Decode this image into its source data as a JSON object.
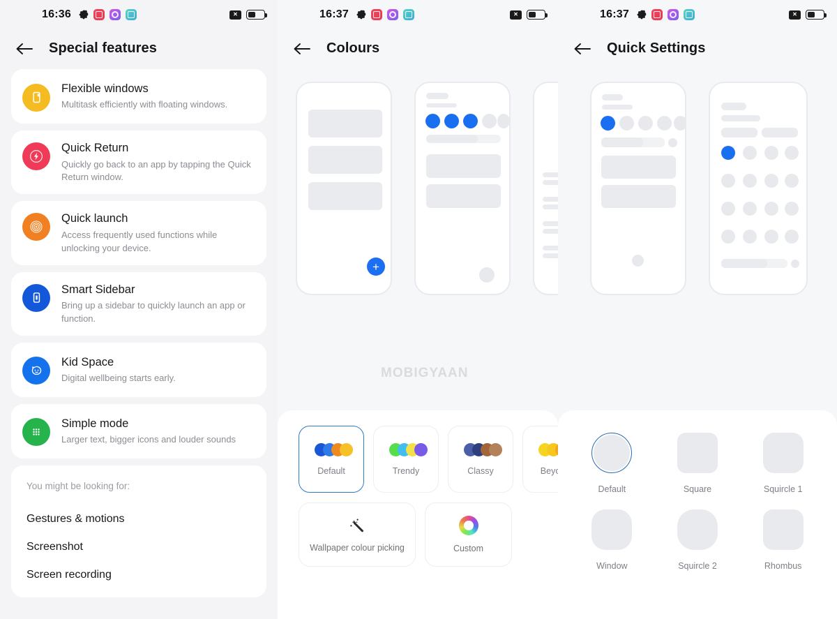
{
  "panels": [
    {
      "id": "special-features",
      "statusbar": {
        "time": "16:36",
        "icons": [
          "gear-icon",
          "app-red-icon",
          "app-purple-icon",
          "app-teal-icon"
        ],
        "right_icons": [
          "x-badge-icon",
          "battery-icon"
        ],
        "battery_level": "48%"
      },
      "appbar": {
        "back": "back-arrow",
        "title": "Special features"
      },
      "features": [
        {
          "title": "Flexible windows",
          "subtitle": "Multitask efficiently with floating windows.",
          "icon": "window-icon",
          "color": "#f5bc21"
        },
        {
          "title": "Quick Return",
          "subtitle": "Quickly go back to an app by tapping the Quick Return window.",
          "icon": "lightning-circle-icon",
          "color": "#ef3b57"
        },
        {
          "title": "Quick launch",
          "subtitle": "Access frequently used functions while unlocking your device.",
          "icon": "fingerprint-icon",
          "color": "#f08021"
        },
        {
          "title": "Smart Sidebar",
          "subtitle": "Bring up a sidebar to quickly launch an app or function.",
          "icon": "sidebar-icon",
          "color": "#1258d8"
        },
        {
          "title": "Kid Space",
          "subtitle": "Digital wellbeing starts early.",
          "icon": "kid-face-icon",
          "color": "#1472ec"
        },
        {
          "title": "Simple mode",
          "subtitle": "Larger text, bigger icons and louder sounds",
          "icon": "grid-dots-icon",
          "color": "#27b34c"
        }
      ],
      "looking_for": {
        "header": "You might be looking for:",
        "items": [
          "Gestures & motions",
          "Screenshot",
          "Screen recording"
        ]
      }
    },
    {
      "id": "colours",
      "statusbar": {
        "time": "16:37",
        "icons": [
          "gear-icon",
          "app-red-icon",
          "app-purple-icon",
          "app-teal-icon"
        ],
        "right_icons": [
          "x-badge-icon",
          "battery-icon"
        ],
        "battery_level": "48%"
      },
      "appbar": {
        "back": "back-arrow",
        "title": "Colours"
      },
      "watermark": "MOBIGYAAN",
      "fab": "+",
      "themes": [
        {
          "label": "Default",
          "selected": true,
          "colors": [
            "#1a57d6",
            "#2f7ae8",
            "#ef8a1f",
            "#f5c126"
          ]
        },
        {
          "label": "Trendy",
          "selected": false,
          "colors": [
            "#55dd4a",
            "#42bdf0",
            "#f3e04b",
            "#7a5ae8"
          ]
        },
        {
          "label": "Classy",
          "selected": false,
          "colors": [
            "#4a5fa8",
            "#2d3f7d",
            "#a0653b",
            "#b3815a"
          ]
        },
        {
          "label": "Beyond",
          "selected": false,
          "colors": [
            "#f5d522",
            "#f7c71f",
            "#f0a81c",
            "#eb8e18"
          ]
        }
      ],
      "utilities": [
        {
          "label": "Wallpaper colour picking",
          "icon": "magic-wand-icon"
        },
        {
          "label": "Custom",
          "icon": "colour-wheel-icon"
        }
      ]
    },
    {
      "id": "quick-settings",
      "statusbar": {
        "time": "16:37",
        "icons": [
          "gear-icon",
          "app-red-icon",
          "app-purple-icon",
          "app-teal-icon"
        ],
        "right_icons": [
          "x-badge-icon",
          "battery-icon"
        ],
        "battery_level": "48%"
      },
      "appbar": {
        "back": "back-arrow",
        "title": "Quick Settings"
      },
      "shapes": [
        {
          "label": "Default",
          "selected": true,
          "shape": "circle-outline"
        },
        {
          "label": "Square",
          "selected": false,
          "shape": "rounded-square"
        },
        {
          "label": "Squircle 1",
          "selected": false,
          "shape": "squircle-1"
        },
        {
          "label": "Window",
          "selected": false,
          "shape": "window-shape"
        },
        {
          "label": "Squircle 2",
          "selected": false,
          "shape": "squircle-2"
        },
        {
          "label": "Rhombus",
          "selected": false,
          "shape": "rhombus-shape"
        }
      ]
    }
  ],
  "accent": "#1d6ff2",
  "selected_border": "#2b79c9"
}
